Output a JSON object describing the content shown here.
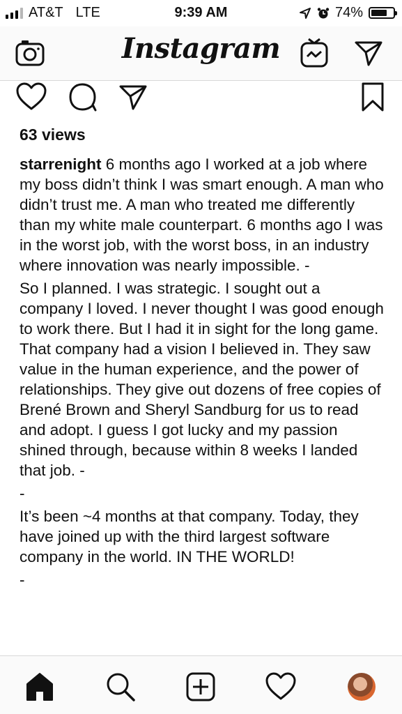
{
  "status_bar": {
    "carrier": "AT&T",
    "network": "LTE",
    "time": "9:39 AM",
    "battery": "74%",
    "battery_level": 0.74,
    "signal_bars": 3,
    "icons": [
      "location-arrow-icon",
      "alarm-icon"
    ]
  },
  "header": {
    "logo_text": "Instagram",
    "left_icon": "camera-icon",
    "right_icons": [
      "igtv-icon",
      "direct-message-icon"
    ]
  },
  "post_actions": {
    "icons": [
      "heart-icon",
      "comment-icon",
      "share-icon",
      "bookmark-icon"
    ]
  },
  "post": {
    "views": "63 views",
    "username": "starrenight",
    "paragraphs": [
      " 6 months ago I worked at a job where my boss didn’t think I was smart enough. A man who didn’t trust me. A man who treated me differently than my white male counterpart. 6 months ago I was in the worst job, with the worst boss, in an industry where innovation was nearly impossible. -",
      "So I planned. I was strategic. I sought out a company I loved. I never thought I was good enough to work there. But I had it in sight for the long game. That company had a vision I believed in. They saw value in the human experience, and the power of relationships. They give out dozens of free copies of Brené Brown and Sheryl Sandburg for us to read and adopt. I guess I got lucky and my passion shined through, because within 8 weeks I landed that job. -",
      "-",
      "It’s been ~4 months at that company. Today, they have joined up with the third largest software company in the world. IN THE WORLD!",
      "-"
    ]
  },
  "tab_bar": {
    "icons": [
      "home-icon",
      "search-icon",
      "new-post-icon",
      "activity-heart-icon",
      "profile-avatar"
    ]
  },
  "colors": {
    "background": "#ffffff",
    "bar_background": "#fafafa",
    "divider": "#d8d8d8",
    "text": "#111111"
  }
}
